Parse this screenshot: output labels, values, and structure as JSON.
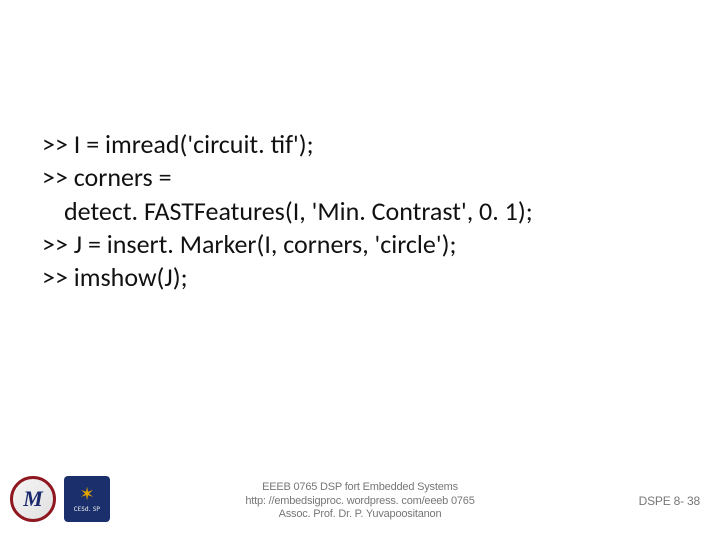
{
  "code": {
    "line1": ">> I = imread('circuit. tif');",
    "line2": ">> corners =",
    "line3": "detect. FASTFeatures(I, 'Min. Contrast', 0. 1);",
    "line4": ">> J = insert. Marker(I, corners, 'circle');",
    "line5": ">> imshow(J);"
  },
  "logos": {
    "monogram": "M",
    "cesdsp_star": "✶",
    "cesdsp_label": "CESd. SP"
  },
  "footer": {
    "line1": "EEEB 0765  DSP fort Embedded Systems",
    "line2": "http: //embedsigproc. wordpress. com/eeeb 0765",
    "line3": "Assoc. Prof. Dr. P. Yuvapoositanon"
  },
  "page_number": "DSPE 8- 38"
}
